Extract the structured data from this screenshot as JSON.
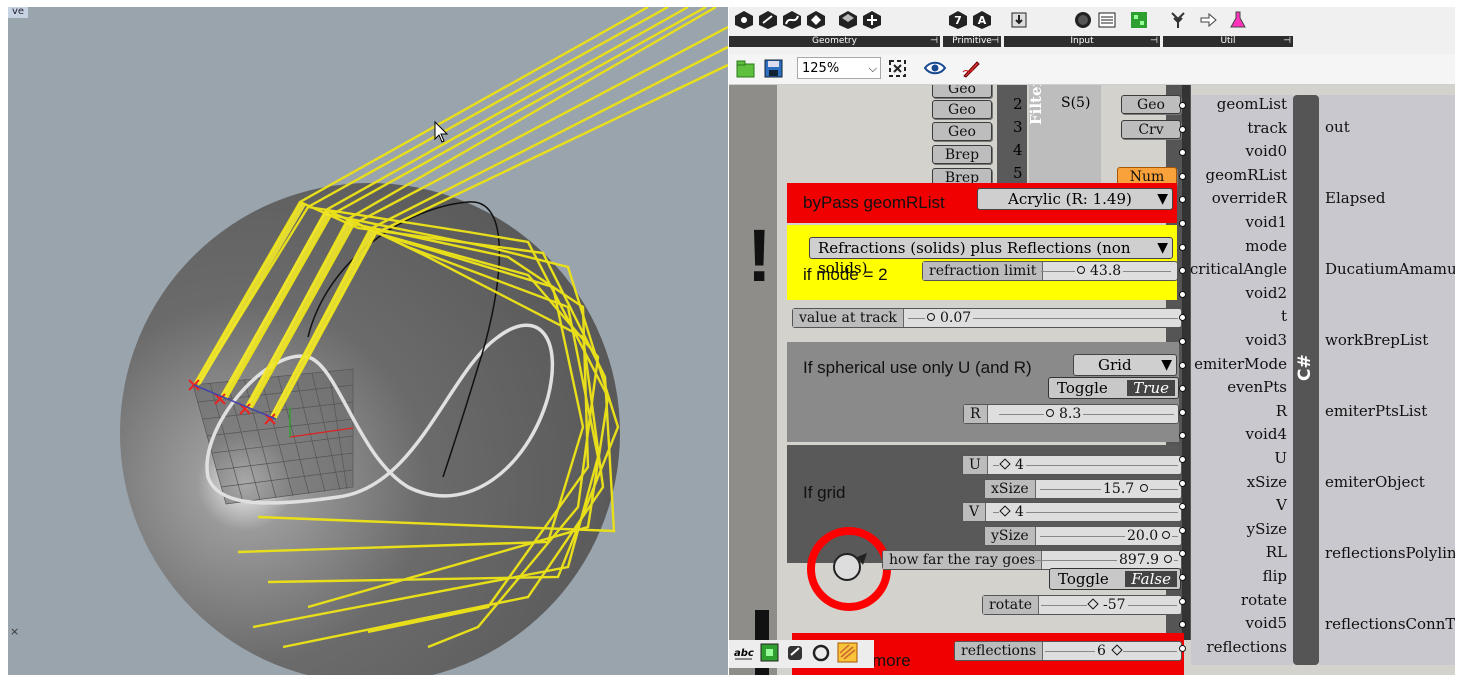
{
  "viewport": {
    "tab": "ve",
    "corner_mark": "×"
  },
  "ribbon": {
    "groups": [
      {
        "label": "Geometry",
        "icons": [
          "point-icon",
          "vector-icon",
          "curve-icon",
          "surface-icon",
          "mesh-icon",
          "field-icon"
        ]
      },
      {
        "label": "Primitive",
        "icons": [
          "integer-7-icon",
          "text-a-icon"
        ]
      },
      {
        "label": "Input",
        "icons": [
          "import-icon",
          "button-icon",
          "list-icon",
          "gradient-icon"
        ]
      },
      {
        "label": "Util",
        "icons": [
          "tree-icon",
          "arrow-icon",
          "flask-icon"
        ]
      }
    ],
    "pin": "⊣"
  },
  "toolbar": {
    "zoom": "125%"
  },
  "filter": {
    "label": "Filter",
    "inputs": [
      "Geo",
      "Geo",
      "Geo",
      "Brep",
      "Brep"
    ],
    "numbers": [
      "2",
      "3",
      "4",
      "5"
    ],
    "stream": "S(5)",
    "outputs": [
      "Geo",
      "Crv",
      "Num"
    ]
  },
  "bypass": {
    "title": "byPass geomRList",
    "material": "Acrylic (R: 1.49)"
  },
  "mode_group": {
    "dropdown": "Refractions (solids)  plus  Reflections (non solids)",
    "condition": "if mode = 2",
    "slider_label": "refraction limit",
    "slider_value": "43.8"
  },
  "track": {
    "label": "value at track",
    "value": "0.07"
  },
  "spherical": {
    "title": "If spherical use only U (and R)",
    "mode": "Grid",
    "toggle_label": "Toggle",
    "toggle_value": "True",
    "r_label": "R",
    "r_value": "8.3"
  },
  "grid": {
    "title": "If grid",
    "u_label": "U",
    "u_value": "4",
    "xsize_label": "xSize",
    "xsize_value": "15.7",
    "v_label": "V",
    "v_value": "4",
    "ysize_label": "ySize",
    "ysize_value": "20.0",
    "howfar_label": "how far the ray goes",
    "howfar_value": "897.9",
    "toggle_label": "Toggle",
    "toggle_value": "False",
    "rotate_label": "rotate",
    "rotate_value": "-57"
  },
  "more": {
    "title": "more",
    "refl_label": "reflections",
    "refl_value": "6"
  },
  "csharp": {
    "name": "C#",
    "inputs": [
      "geomList",
      "track",
      "void0",
      "geomRList",
      "overrideR",
      "void1",
      "mode",
      "criticalAngle",
      "void2",
      "t",
      "void3",
      "emiterMode",
      "evenPts",
      "R",
      "void4",
      "U",
      "xSize",
      "V",
      "ySize",
      "RL",
      "flip",
      "rotate",
      "void5",
      "reflections"
    ],
    "outputs": [
      "out",
      "Elapsed",
      "DucatiumAmamusD",
      "workBrepList",
      "emiterPtsList",
      "emiterObject",
      "reflectionsPolylineL",
      "reflectionsConnToB"
    ]
  },
  "bottom": {
    "icons": [
      "abc-icon",
      "plugin-icon",
      "link-icon",
      "circle-icon",
      "wave-icon"
    ]
  },
  "colors": {
    "accent_red": "#ff0000",
    "accent_yellow": "#ffff00",
    "ray_yellow": "#e8df1a"
  }
}
